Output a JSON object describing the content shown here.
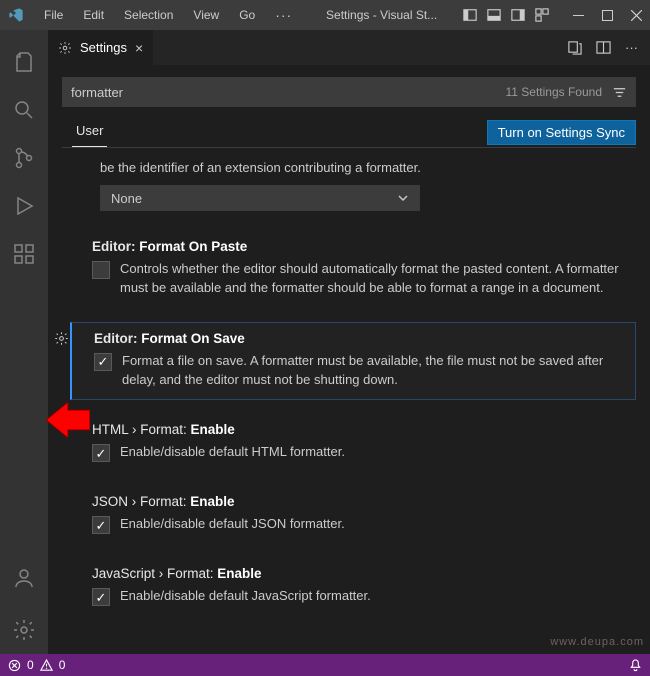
{
  "titlebar": {
    "menus": [
      "File",
      "Edit",
      "Selection",
      "View",
      "Go"
    ],
    "title": "Settings - Visual St..."
  },
  "tab": {
    "label": "Settings"
  },
  "search": {
    "value": "formatter",
    "found_label": "11 Settings Found"
  },
  "scope": {
    "tab_label": "User",
    "sync_button": "Turn on Settings Sync"
  },
  "partial_top": {
    "desc": "be the identifier of an extension contributing a formatter.",
    "dropdown_value": "None"
  },
  "settings": {
    "format_on_paste": {
      "prefix": "Editor:",
      "name": "Format On Paste",
      "desc": "Controls whether the editor should automatically format the pasted content. A formatter must be available and the formatter should be able to format a range in a document.",
      "checked": false
    },
    "format_on_save": {
      "prefix": "Editor:",
      "name": "Format On Save",
      "desc": "Format a file on save. A formatter must be available, the file must not be saved after delay, and the editor must not be shutting down.",
      "checked": true
    },
    "html_format_enable": {
      "crumb": "HTML › Format:",
      "name": "Enable",
      "desc": "Enable/disable default HTML formatter.",
      "checked": true
    },
    "json_format_enable": {
      "crumb": "JSON › Format:",
      "name": "Enable",
      "desc": "Enable/disable default JSON formatter.",
      "checked": true
    },
    "js_format_enable": {
      "crumb": "JavaScript › Format:",
      "name": "Enable",
      "desc": "Enable/disable default JavaScript formatter.",
      "checked": true
    }
  },
  "statusbar": {
    "errors": "0",
    "warnings": "0"
  },
  "watermark": "www.deupa.com"
}
